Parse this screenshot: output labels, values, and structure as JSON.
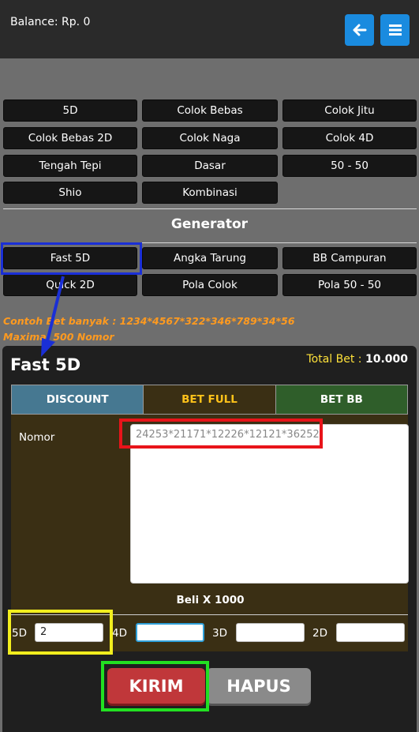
{
  "header": {
    "balance": "Balance: Rp. 0",
    "back_icon": "arrow-left-icon",
    "menu_icon": "hamburger-menu-icon",
    "button_color": "#1a8bdf"
  },
  "games": [
    "5D",
    "Colok Bebas",
    "Colok Jitu",
    "Colok Bebas 2D",
    "Colok Naga",
    "Colok 4D",
    "Tengah Tepi",
    "Dasar",
    "50 - 50",
    "Shio",
    "Kombinasi"
  ],
  "generator": {
    "title": "Generator",
    "items": [
      "Fast 5D",
      "Angka Tarung",
      "BB Campuran",
      "Quick 2D",
      "Pola Colok",
      "Pola 50 - 50"
    ]
  },
  "hints": {
    "line1": "Contoh Bet banyak : 1234*4567*322*346*789*34*56",
    "line2": "Maximal 500 Nomor"
  },
  "panel": {
    "title": "Fast 5D",
    "total_label": "Total Bet :",
    "total_value": "10.000",
    "tabs": [
      "DISCOUNT",
      "BET FULL",
      "BET BB"
    ],
    "nomor_label": "Nomor",
    "nomor_placeholder": "24253*21171*12226*12121*36252",
    "beli": "Beli X 1000",
    "inputs": [
      {
        "label": "5D",
        "value": "2"
      },
      {
        "label": "4D",
        "value": ""
      },
      {
        "label": "3D",
        "value": ""
      },
      {
        "label": "2D",
        "value": ""
      }
    ],
    "submit_label": "KIRIM",
    "clear_label": "HAPUS"
  },
  "colors": {
    "accent": "#ffc21a",
    "hint": "#ff9a1f",
    "kirim": "#c0373a",
    "annotation_blue": "#1a2fd6",
    "annotation_red": "#e8141a",
    "annotation_yellow": "#f2ee1e",
    "annotation_green": "#22e022"
  }
}
